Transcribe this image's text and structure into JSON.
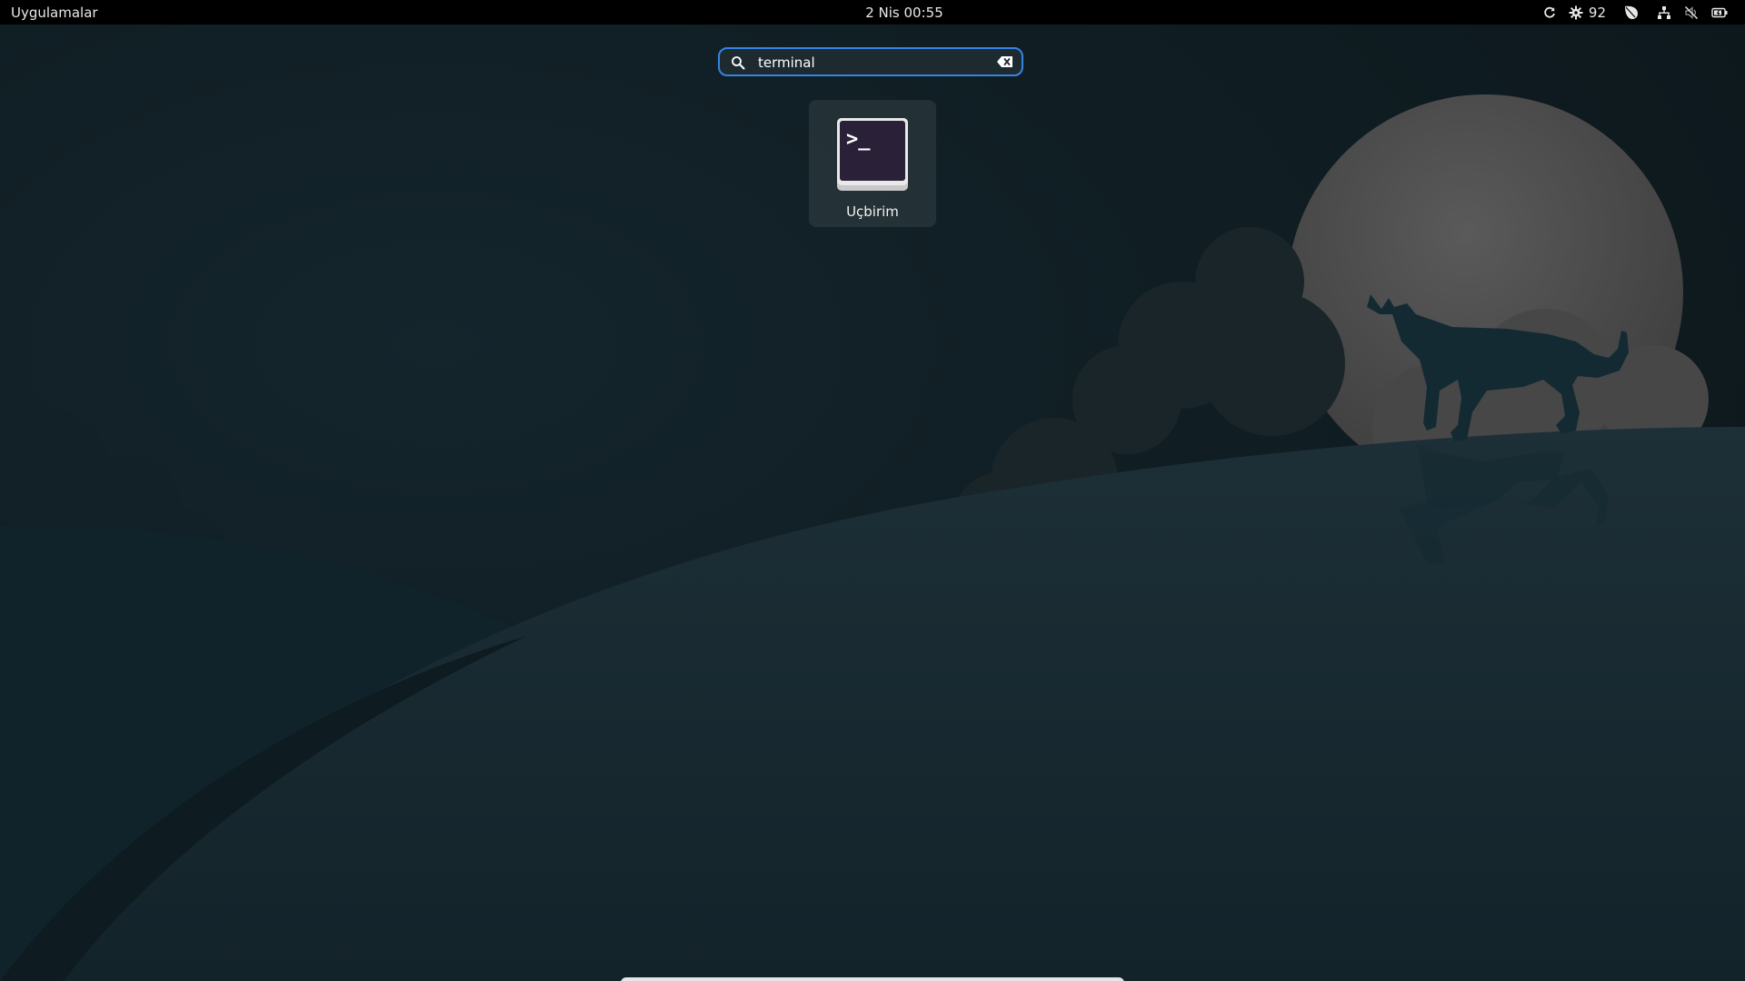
{
  "topbar": {
    "activities_label": "Uygulamalar",
    "clock": "2 Nis  00:55",
    "tray": {
      "refresh_icon": "refresh-icon",
      "brightness_icon": "gear-icon",
      "brightness_value": "92",
      "leaf_icon": "leaf-icon",
      "network_icon": "network-icon",
      "mute_icon": "muted-icon",
      "battery_icon": "battery-icon"
    }
  },
  "search": {
    "value": "terminal",
    "icon": "search-icon",
    "clear_icon": "clear-icon"
  },
  "results": [
    {
      "label": "Uçbirim",
      "icon": "terminal-icon",
      "prompt": ">_"
    }
  ],
  "colors": {
    "accent": "#3584e4",
    "topbar": "#000000",
    "moon": "#4a4a4a",
    "hill": "#1a2a31"
  }
}
